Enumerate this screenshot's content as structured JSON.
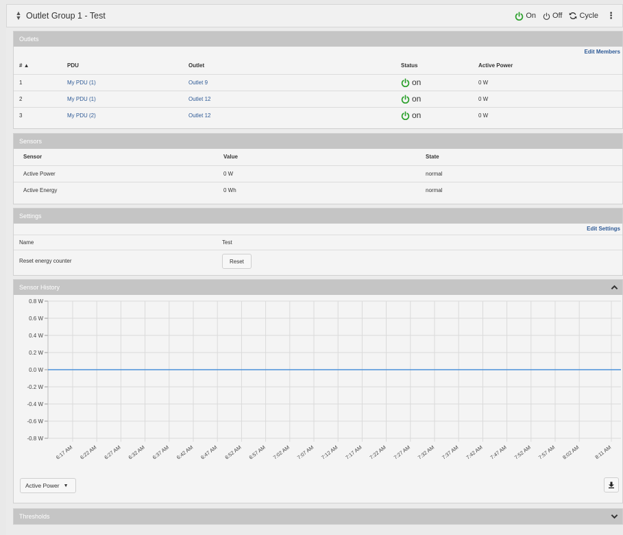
{
  "header": {
    "title": "Outlet Group 1 - Test",
    "on_label": "On",
    "off_label": "Off",
    "cycle_label": "Cycle"
  },
  "outlets": {
    "title": "Outlets",
    "edit_link": "Edit Members",
    "columns": [
      "# ▲",
      "PDU",
      "Outlet",
      "Status",
      "Active Power"
    ],
    "rows": [
      {
        "num": "1",
        "pdu": "My PDU (1)",
        "outlet": "Outlet 9",
        "status": "on",
        "power": "0 W"
      },
      {
        "num": "2",
        "pdu": "My PDU (1)",
        "outlet": "Outlet 12",
        "status": "on",
        "power": "0 W"
      },
      {
        "num": "3",
        "pdu": "My PDU (2)",
        "outlet": "Outlet 12",
        "status": "on",
        "power": "0 W"
      }
    ]
  },
  "sensors": {
    "title": "Sensors",
    "columns": [
      "Sensor",
      "Value",
      "State"
    ],
    "rows": [
      {
        "sensor": "Active Power",
        "value": "0 W",
        "state": "normal"
      },
      {
        "sensor": "Active Energy",
        "value": "0 Wh",
        "state": "normal"
      }
    ]
  },
  "settings": {
    "title": "Settings",
    "edit_link": "Edit Settings",
    "name_label": "Name",
    "name_value": "Test",
    "reset_label": "Reset energy counter",
    "reset_button": "Reset"
  },
  "history": {
    "title": "Sensor History",
    "dropdown_value": "Active Power",
    "chart_data": {
      "type": "line",
      "title": "",
      "xlabel": "",
      "ylabel": "",
      "x": [
        "6:17 AM",
        "6:22 AM",
        "6:27 AM",
        "6:32 AM",
        "6:37 AM",
        "6:42 AM",
        "6:47 AM",
        "6:52 AM",
        "6:57 AM",
        "7:02 AM",
        "7:07 AM",
        "7:12 AM",
        "7:17 AM",
        "7:22 AM",
        "7:27 AM",
        "7:32 AM",
        "7:37 AM",
        "7:42 AM",
        "7:47 AM",
        "7:52 AM",
        "7:57 AM",
        "8:02 AM",
        "8:11 AM"
      ],
      "y_ticks": [
        "0.8 W",
        "0.6 W",
        "0.4 W",
        "0.2 W",
        "0.0 W",
        "-0.2 W",
        "-0.4 W",
        "-0.6 W",
        "-0.8 W"
      ],
      "ylim": [
        -0.8,
        0.8
      ],
      "grid": true,
      "series": [
        {
          "values": [
            0,
            0,
            0,
            0,
            0,
            0,
            0,
            0,
            0,
            0,
            0,
            0,
            0,
            0,
            0,
            0,
            0,
            0,
            0,
            0,
            0,
            0,
            0
          ],
          "color": "#4a90d9"
        }
      ]
    }
  },
  "thresholds": {
    "title": "Thresholds"
  },
  "colors": {
    "on_green": "#2ea12e",
    "link": "#2e5a96",
    "panel_head": "#c5c5c5",
    "line": "#4a90d9"
  }
}
